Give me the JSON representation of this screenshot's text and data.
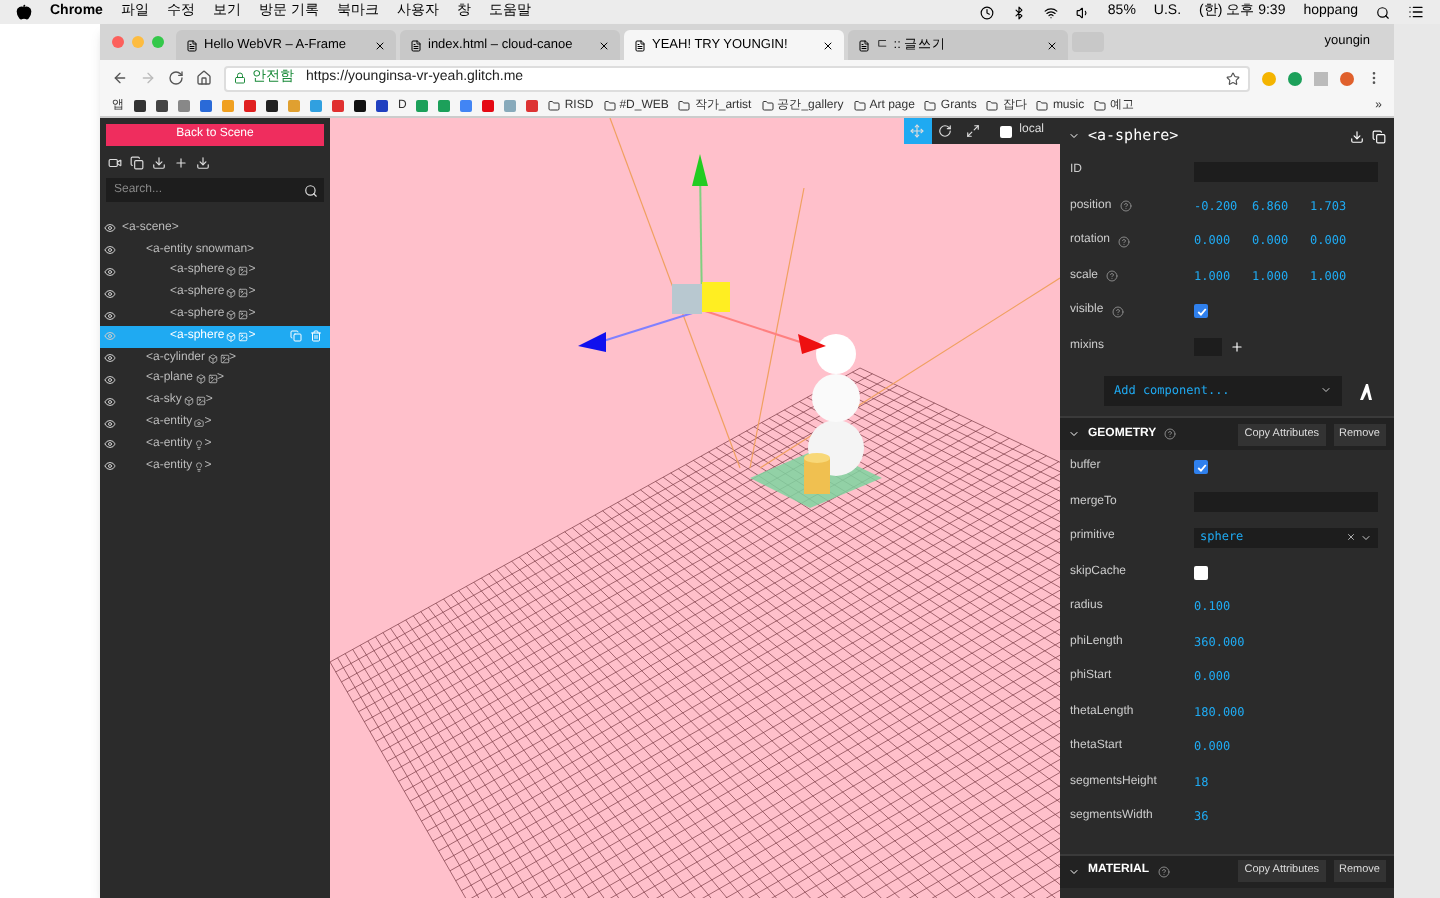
{
  "menubar": {
    "app": "Chrome",
    "menus": [
      "파일",
      "수정",
      "보기",
      "방문 기록",
      "북마크",
      "사용자",
      "창",
      "도움말"
    ],
    "battery": "85%",
    "input_source": "U.S.",
    "clock": "(한) 오후 9:39",
    "user": "hoppang"
  },
  "tabs": [
    {
      "title": "Hello WebVR – A-Frame",
      "selected": false
    },
    {
      "title": "index.html – cloud-canoe",
      "selected": false
    },
    {
      "title": "YEAH! TRY YOUNGIN!",
      "selected": true
    },
    {
      "title": "ㄷ :: 글쓰기",
      "selected": false
    }
  ],
  "profile": "youngin",
  "address": {
    "security": "안전함",
    "url": "https://younginsa-vr-yeah.glitch.me"
  },
  "bookmarks": [
    "앱",
    "D",
    "RISD",
    "#D_WEB",
    "작가_artist",
    "공간_gallery",
    "Art page",
    "Grants",
    "잡다",
    "music",
    "예고",
    "»"
  ],
  "scene_panel": {
    "back_button": "Back to Scene",
    "search": {
      "placeholder": "Search..."
    },
    "tree": [
      {
        "label": "<a-scene>",
        "selected": false,
        "children": [
          {
            "label": "<a-entity snowman>",
            "selected": false,
            "children": [
              {
                "label": "<a-sphere",
                "kind": "mesh",
                "end": ">",
                "selected": false
              },
              {
                "label": "<a-sphere",
                "kind": "mesh",
                "end": ">",
                "selected": false
              },
              {
                "label": "<a-sphere",
                "kind": "mesh",
                "end": ">",
                "selected": false
              },
              {
                "label": "<a-sphere",
                "kind": "mesh",
                "end": ">",
                "selected": true
              }
            ]
          },
          {
            "label": "<a-cylinder",
            "kind": "mesh",
            "end": ">",
            "selected": false
          },
          {
            "label": "<a-plane",
            "kind": "mesh",
            "end": ">",
            "selected": false
          },
          {
            "label": "<a-sky",
            "kind": "mesh",
            "end": ">",
            "selected": false
          },
          {
            "label": "<a-entity",
            "kind": "camera",
            "end": ">",
            "selected": false
          },
          {
            "label": "<a-entity",
            "kind": "light",
            "end": ">",
            "selected": false
          },
          {
            "label": "<a-entity",
            "kind": "light",
            "end": ">",
            "selected": false
          }
        ]
      }
    ]
  },
  "viewport_toolbar": {
    "modes": [
      {
        "kind": "translate",
        "selected": true
      },
      {
        "kind": "rotate",
        "selected": false
      },
      {
        "kind": "scale",
        "selected": false
      }
    ],
    "local": {
      "label": "local",
      "checked": false
    }
  },
  "inspector": {
    "title": "<a-sphere>",
    "rows": [
      {
        "kind": "text",
        "label": "ID",
        "value": ""
      },
      {
        "kind": "vec3",
        "label": "position",
        "values": [
          "-0.200",
          "6.860",
          "1.703"
        ]
      },
      {
        "kind": "vec3",
        "label": "rotation",
        "values": [
          "0.000",
          "0.000",
          "0.000"
        ]
      },
      {
        "kind": "vec3",
        "label": "scale",
        "values": [
          "1.000",
          "1.000",
          "1.000"
        ]
      },
      {
        "kind": "checkbox",
        "label": "visible",
        "checked": true
      },
      {
        "kind": "mixins",
        "label": "mixins"
      }
    ],
    "add_component": "Add component...",
    "sections": [
      {
        "title": "GEOMETRY",
        "expanded": true,
        "buttons": [
          "Copy Attributes",
          "Remove"
        ],
        "rows": [
          {
            "kind": "checkbox",
            "label": "buffer",
            "checked": true
          },
          {
            "kind": "text",
            "label": "mergeTo",
            "value": ""
          },
          {
            "kind": "select",
            "label": "primitive",
            "value": "sphere"
          },
          {
            "kind": "checkbox",
            "label": "skipCache",
            "checked": false
          },
          {
            "kind": "number",
            "label": "radius",
            "value": "0.100"
          },
          {
            "kind": "number",
            "label": "phiLength",
            "value": "360.000"
          },
          {
            "kind": "number",
            "label": "phiStart",
            "value": "0.000"
          },
          {
            "kind": "number",
            "label": "thetaLength",
            "value": "180.000"
          },
          {
            "kind": "number",
            "label": "thetaStart",
            "value": "0.000"
          },
          {
            "kind": "number",
            "label": "segmentsHeight",
            "value": "18"
          },
          {
            "kind": "number",
            "label": "segmentsWidth",
            "value": "36"
          }
        ]
      },
      {
        "title": "MATERIAL",
        "expanded": true,
        "buttons": [
          "Copy Attributes",
          "Remove"
        ]
      }
    ]
  }
}
